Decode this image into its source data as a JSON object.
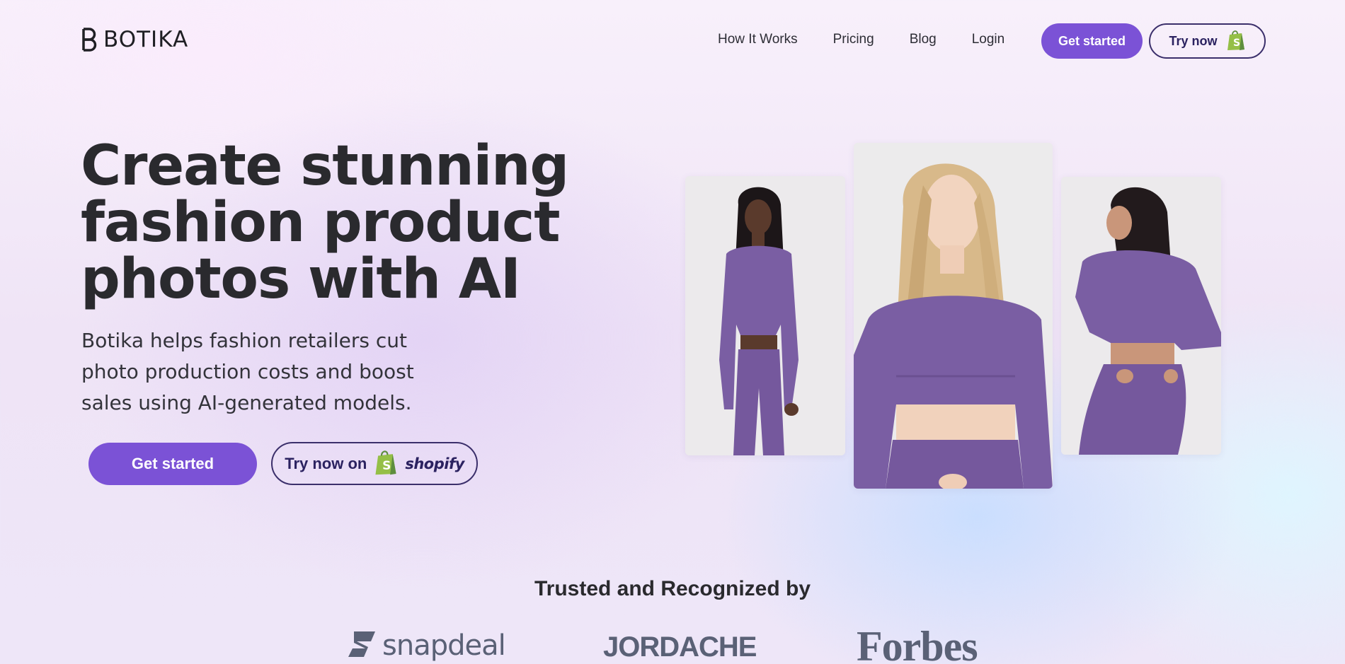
{
  "nav": {
    "logo_text": "BOTIKA",
    "links": [
      "How It Works",
      "Pricing",
      "Blog",
      "Login"
    ],
    "get_started_label": "Get started",
    "try_now_label": "Try now"
  },
  "hero": {
    "title": "Create stunning fashion product photos with AI",
    "subtitle": "Botika helps fashion retailers cut photo production costs and boost sales using AI-generated models.",
    "get_started_label": "Get started",
    "try_now_label": "Try now on",
    "shopify_label": "shopify"
  },
  "photos": [
    {
      "icon": "model-photo-front",
      "outfit_color": "#7a5ea3"
    },
    {
      "icon": "model-photo-closeup",
      "outfit_color": "#7a5ea3"
    },
    {
      "icon": "model-photo-back",
      "outfit_color": "#7a5ea3"
    }
  ],
  "trust": {
    "title": "Trusted and Recognized by",
    "brands": [
      "snapdeal",
      "JORDACHE",
      "Forbes"
    ]
  },
  "colors": {
    "accent": "#7b52d6",
    "outline": "#3b2f6b",
    "shopify_green": "#95bf47"
  }
}
